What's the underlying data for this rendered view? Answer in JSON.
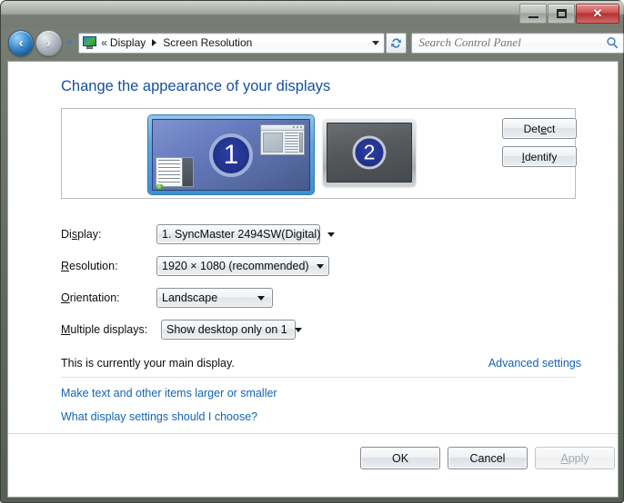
{
  "window": {
    "caption": {
      "minimize_label": "Minimize",
      "maximize_label": "Maximize",
      "close_glyph": "✕"
    }
  },
  "navbar": {
    "back_glyph": "‹",
    "forward_glyph": "›",
    "breadcrumb": {
      "overflow_chevrons": "«",
      "items": [
        {
          "label": "Display"
        },
        {
          "label": "Screen Resolution"
        }
      ]
    },
    "search": {
      "value": "",
      "placeholder": "Search Control Panel"
    }
  },
  "main": {
    "heading": "Change the appearance of your displays",
    "preview": {
      "monitors": [
        {
          "number": "1",
          "state": "selected"
        },
        {
          "number": "2",
          "state": "inactive"
        }
      ]
    },
    "side_buttons": {
      "detect": {
        "pre": "Det",
        "accel": "e",
        "post": "ct"
      },
      "identify": {
        "pre": "",
        "accel": "I",
        "post": "dentify"
      }
    },
    "fields": [
      {
        "label_pre": "Di",
        "label_accel": "s",
        "label_post": "play:",
        "value": "1. SyncMaster 2494SW(Digital)"
      },
      {
        "label_pre": "",
        "label_accel": "R",
        "label_post": "esolution:",
        "value": "1920 × 1080 (recommended)"
      },
      {
        "label_pre": "",
        "label_accel": "O",
        "label_post": "rientation:",
        "value": "Landscape"
      },
      {
        "label_pre": "",
        "label_accel": "M",
        "label_post": "ultiple displays:",
        "value": "Show desktop only on 1"
      }
    ],
    "status_text": "This is currently your main display.",
    "advanced_settings_link": "Advanced settings",
    "links": [
      "Make text and other items larger or smaller",
      "What display settings should I choose?"
    ]
  },
  "footer": {
    "ok": "OK",
    "cancel": "Cancel",
    "apply": {
      "pre": "",
      "accel": "A",
      "post": "pply",
      "disabled": true
    }
  },
  "colors": {
    "heading_blue": "#14509e",
    "link_blue": "#1263b6",
    "monitor_selected": "#3d8fd0",
    "monitor_badge": "#23338c",
    "close_red": "#b53131"
  }
}
